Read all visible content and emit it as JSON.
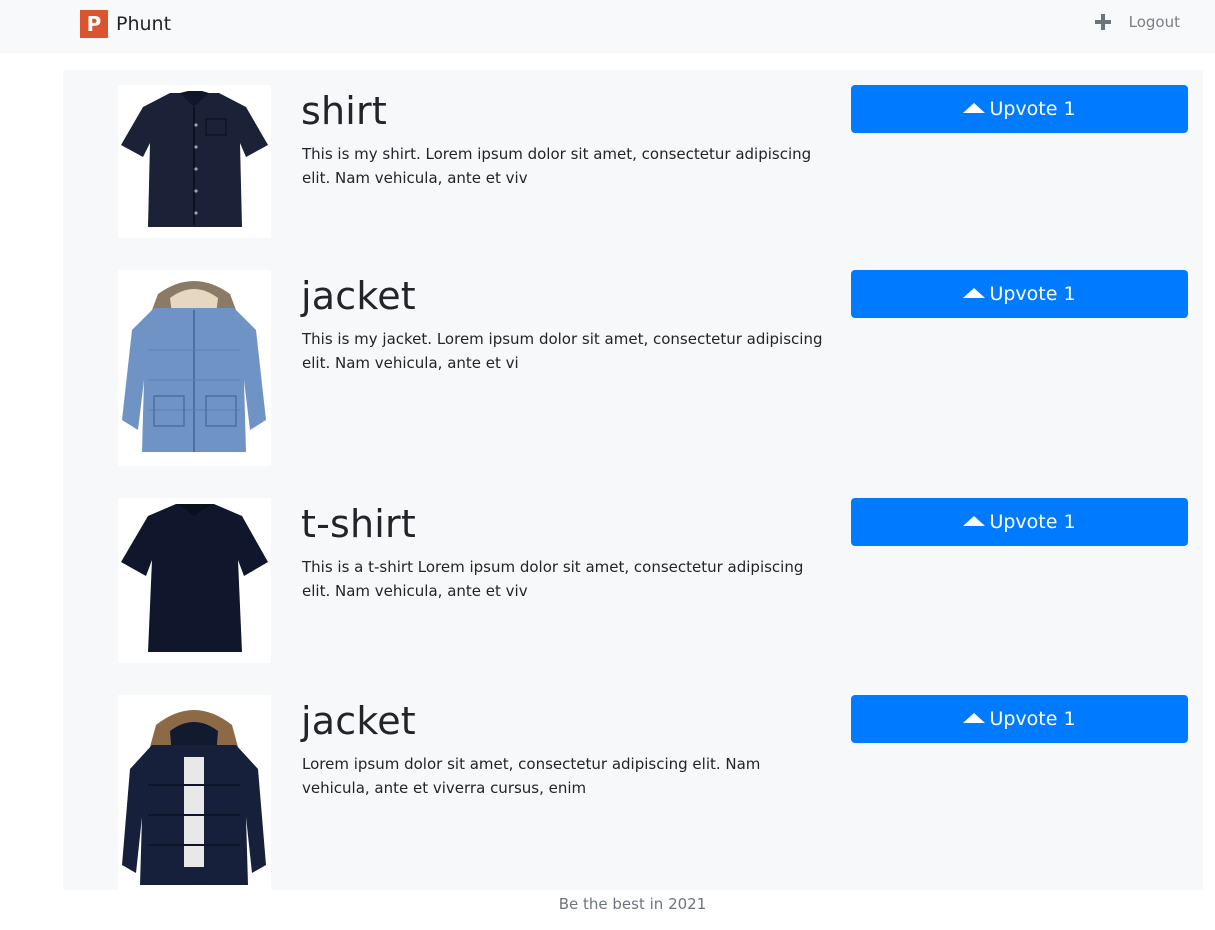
{
  "navbar": {
    "logo_letter": "P",
    "brand": "Phunt",
    "add_icon": "plus-icon",
    "logout_label": "Logout"
  },
  "posts": [
    {
      "title": "shirt",
      "description": "This is my shirt. Lorem ipsum dolor sit amet, consectetur adipiscing elit. Nam vehicula, ante et viv",
      "upvote_label": "Upvote 1",
      "image": "dark navy short-sleeve shirt"
    },
    {
      "title": "jacket",
      "description": "This is my jacket. Lorem ipsum dolor sit amet, consectetur adipiscing elit. Nam vehicula, ante et vi",
      "upvote_label": "Upvote 1",
      "image": "light blue hooded parka with fur trim"
    },
    {
      "title": "t-shirt",
      "description": "This is a t-shirt Lorem ipsum dolor sit amet, consectetur adipiscing elit. Nam vehicula, ante et viv",
      "upvote_label": "Upvote 1",
      "image": "dark navy short-sleeve shirt back"
    },
    {
      "title": "jacket",
      "description": "Lorem ipsum dolor sit amet, consectetur adipiscing elit. Nam vehicula, ante et viverra cursus, enim",
      "upvote_label": "Upvote 1",
      "image": "navy puffer jacket with fur hood"
    }
  ],
  "footer": {
    "text": "Be the best in 2021"
  },
  "colors": {
    "accent": "#007bff",
    "brand": "#da552f",
    "page_bg": "#f7f8fa",
    "navbar_bg": "#f8f9fa"
  }
}
